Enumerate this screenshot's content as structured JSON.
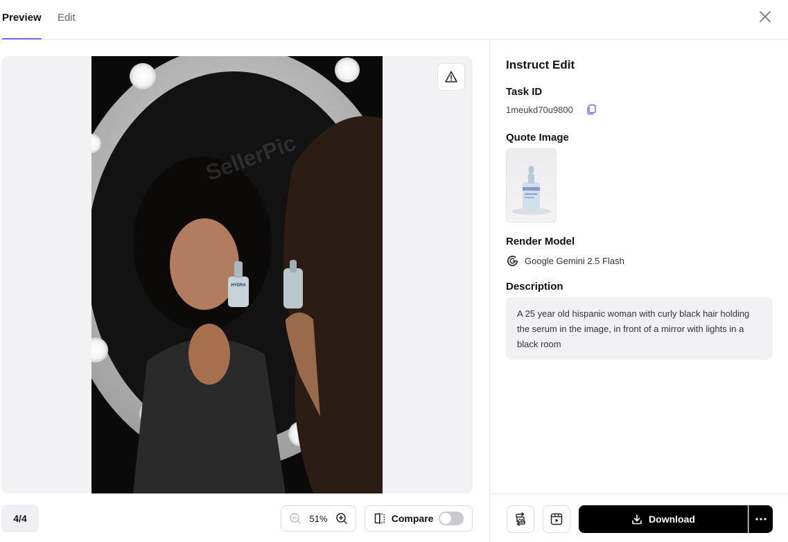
{
  "header": {
    "tabs": [
      {
        "label": "Preview",
        "active": true
      },
      {
        "label": "Edit",
        "active": false
      }
    ]
  },
  "preview": {
    "page_indicator": "4/4",
    "zoom_level": "51%",
    "compare_label": "Compare",
    "compare_enabled": false,
    "watermark": "SellerPic",
    "bottle_label": "HYDRA"
  },
  "panel": {
    "title": "Instruct Edit",
    "task_id_label": "Task ID",
    "task_id_value": "1meukd70u9800",
    "quote_image_label": "Quote Image",
    "render_model_label": "Render Model",
    "render_model_value": "Google Gemini 2.5 Flash",
    "description_label": "Description",
    "description_value": "A 25 year old hispanic woman with curly black hair holding the serum in the image, in front of a mirror with lights in a black room",
    "download_label": "Download"
  },
  "colors": {
    "accent": "#7b5cf0",
    "primary_button": "#000000",
    "surface": "#f2f1f4"
  }
}
